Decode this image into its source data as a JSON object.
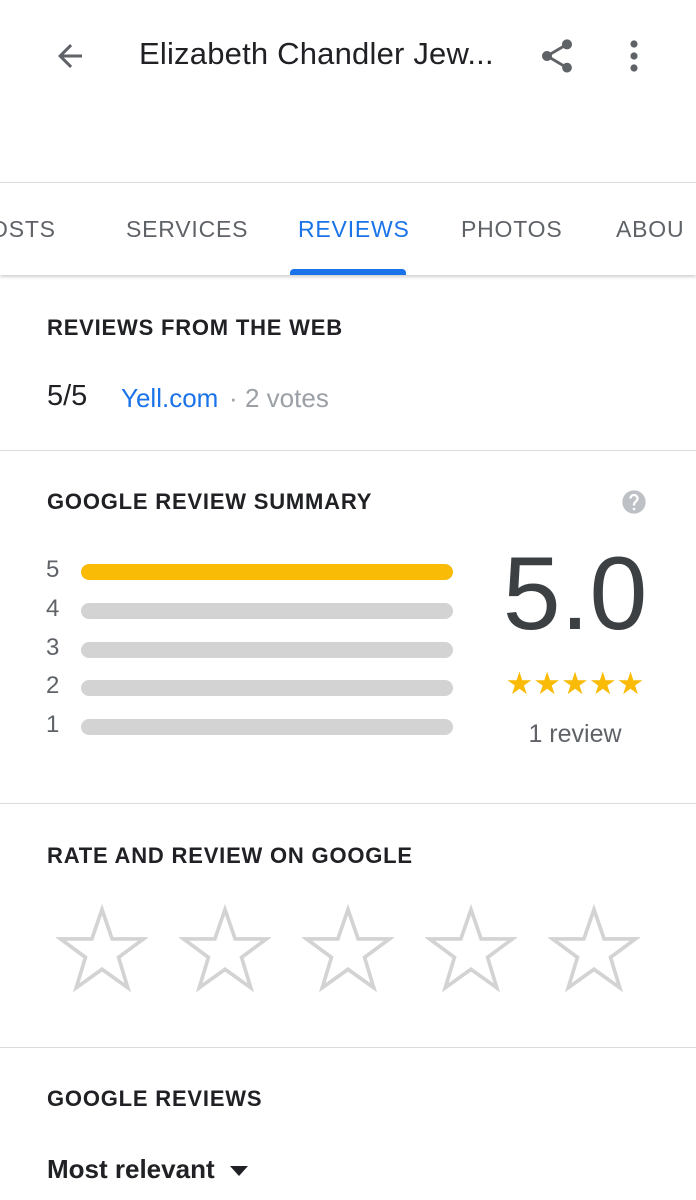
{
  "header": {
    "title": "Elizabeth Chandler Jew..."
  },
  "tabs": [
    {
      "label": "OSTS"
    },
    {
      "label": "SERVICES"
    },
    {
      "label": "REVIEWS",
      "active": true
    },
    {
      "label": "PHOTOS"
    },
    {
      "label": "ABOU"
    }
  ],
  "web_reviews": {
    "heading": "REVIEWS FROM THE WEB",
    "score": "5/5",
    "source": "Yell.com",
    "separator": "·",
    "votes": "2 votes"
  },
  "summary": {
    "heading": "GOOGLE REVIEW SUMMARY",
    "rating": "5.0",
    "stars": "★★★★★",
    "review_count": "1 review",
    "distribution": [
      {
        "label": "5",
        "fraction": 1.0
      },
      {
        "label": "4",
        "fraction": 0.0
      },
      {
        "label": "3",
        "fraction": 0.0
      },
      {
        "label": "2",
        "fraction": 0.0
      },
      {
        "label": "1",
        "fraction": 0.0
      }
    ]
  },
  "rate": {
    "heading": "RATE AND REVIEW ON GOOGLE",
    "star_count": 5
  },
  "google_reviews": {
    "heading": "GOOGLE REVIEWS",
    "sort_label": "Most relevant"
  },
  "colors": {
    "accent": "#1a73e8",
    "star_gold": "#f9bb05",
    "bar_empty": "#d3d3d3"
  }
}
